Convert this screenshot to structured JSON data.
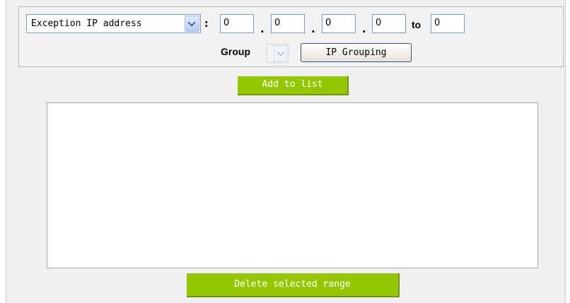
{
  "range": {
    "type_selected": "Exception IP address",
    "colon": ":",
    "start_octets": [
      "0",
      "0",
      "0",
      "0"
    ],
    "separator": ".",
    "to_label": "to",
    "end_octet": "0"
  },
  "group": {
    "label": "Group",
    "selected": "",
    "ip_grouping_button": "IP Grouping"
  },
  "actions": {
    "add_to_list": "Add to list",
    "delete_selected_range": "Delete selected range"
  },
  "list": {
    "items": []
  },
  "colors": {
    "accent_green": "#94c700",
    "panel_bg": "#efefef"
  },
  "icons": {
    "dropdown": "chevron-down-icon"
  }
}
